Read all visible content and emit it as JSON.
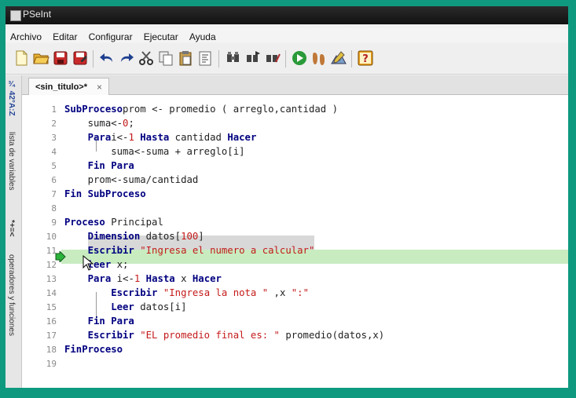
{
  "window": {
    "title": "PSeInt"
  },
  "menu": [
    "Archivo",
    "Editar",
    "Configurar",
    "Ejecutar",
    "Ayuda"
  ],
  "toolbar": {
    "icons": [
      "new-file-icon",
      "open-folder-icon",
      "save-icon",
      "save-as-icon",
      "undo-icon",
      "redo-icon",
      "cut-icon",
      "copy-icon",
      "paste-icon",
      "format-icon",
      "search-icon",
      "search-next-icon",
      "replace-icon",
      "run-icon",
      "step-icon",
      "debug-icon",
      "help-icon"
    ]
  },
  "sidebar": {
    "variables_label": "lista de variables",
    "variables_prefix": "¾ 42°A:Z",
    "operators_label": "operadores y funciones",
    "operators_prefix": "*+=<"
  },
  "tab": {
    "label": "<sin_titulo>*",
    "close": "×"
  },
  "editor": {
    "current_line": 12,
    "lines": [
      {
        "n": "1",
        "t": [
          [
            "kw",
            "SubProceso"
          ],
          [
            "",
            "prom <- promedio ( arreglo,cantidad )"
          ]
        ]
      },
      {
        "n": "2",
        "t": [
          [
            "",
            "    suma<-"
          ],
          [
            "num",
            "0"
          ],
          [
            "",
            ";"
          ]
        ]
      },
      {
        "n": "3",
        "t": [
          [
            "kw",
            "    Para"
          ],
          [
            "",
            "i<-"
          ],
          [
            "num",
            "1"
          ],
          [
            "kw",
            " Hasta"
          ],
          [
            "",
            " cantidad "
          ],
          [
            "kw",
            "Hacer"
          ]
        ]
      },
      {
        "n": "4",
        "t": [
          [
            "",
            "        suma<-suma + arreglo[i]"
          ]
        ]
      },
      {
        "n": "5",
        "t": [
          [
            "kw",
            "    Fin Para"
          ]
        ]
      },
      {
        "n": "6",
        "t": [
          [
            "",
            "    prom<-suma/cantidad"
          ]
        ]
      },
      {
        "n": "7",
        "t": [
          [
            "kw",
            "Fin SubProceso"
          ]
        ]
      },
      {
        "n": "8",
        "t": []
      },
      {
        "n": "9",
        "t": [
          [
            "kw",
            "Proceso"
          ],
          [
            "",
            " Principal"
          ]
        ]
      },
      {
        "n": "10",
        "t": [
          [
            "kw",
            "    Dimension"
          ],
          [
            "",
            " datos["
          ],
          [
            "num",
            "100"
          ],
          [
            "",
            "]"
          ]
        ]
      },
      {
        "n": "11",
        "t": [
          [
            "kw",
            "    Escribir"
          ],
          [
            "str",
            " \"Ingresa el numero a calcular\""
          ]
        ]
      },
      {
        "n": "12",
        "t": [
          [
            "kw",
            "    leer"
          ],
          [
            "",
            " x;"
          ]
        ]
      },
      {
        "n": "13",
        "t": [
          [
            "kw",
            "    Para"
          ],
          [
            "",
            " i<-"
          ],
          [
            "num",
            "1"
          ],
          [
            "kw",
            " Hasta"
          ],
          [
            "",
            " x "
          ],
          [
            "kw",
            "Hacer"
          ]
        ]
      },
      {
        "n": "14",
        "t": [
          [
            "kw",
            "        Escribir"
          ],
          [
            "str",
            " \"Ingresa la nota \""
          ],
          [
            "",
            " ,x "
          ],
          [
            "str",
            "\":\""
          ]
        ]
      },
      {
        "n": "15",
        "t": [
          [
            "kw",
            "        Leer"
          ],
          [
            "",
            " datos[i]"
          ]
        ]
      },
      {
        "n": "16",
        "t": [
          [
            "kw",
            "    Fin Para"
          ]
        ]
      },
      {
        "n": "17",
        "t": [
          [
            "kw",
            "    Escribir"
          ],
          [
            "str",
            " \"EL promedio final es: \""
          ],
          [
            "",
            " promedio(datos,x)"
          ]
        ]
      },
      {
        "n": "18",
        "t": [
          [
            "kw",
            "FinProceso"
          ]
        ]
      },
      {
        "n": "19",
        "t": []
      }
    ]
  }
}
